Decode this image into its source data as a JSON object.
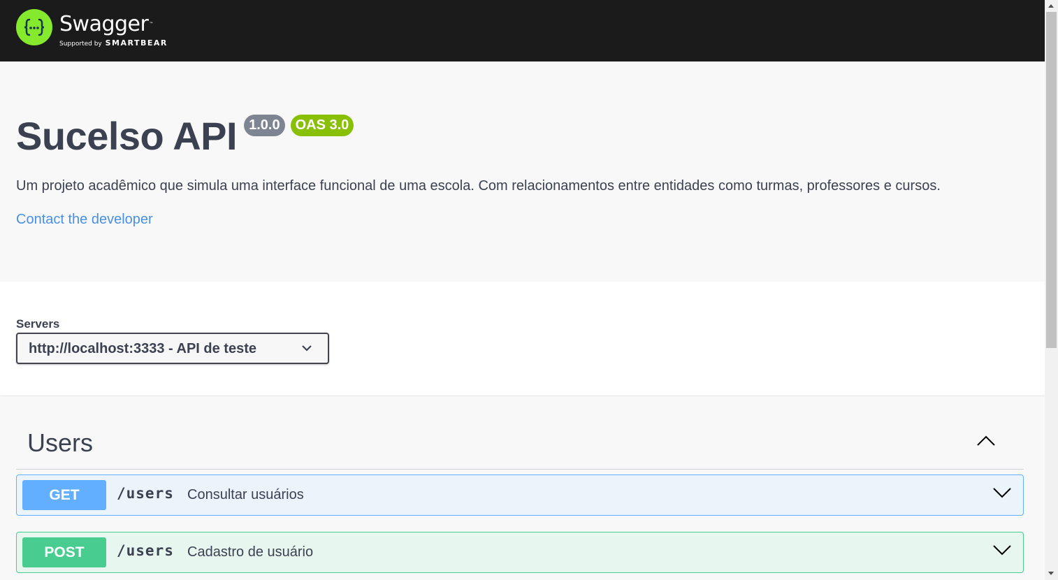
{
  "topbar": {
    "logo_name": "Swagger",
    "logo_tm": "™",
    "supported_by": "Supported by",
    "brand": "SMARTBEAR",
    "logo_color": "#85ea2d"
  },
  "info": {
    "title": "Sucelso API",
    "version_badge": "1.0.0",
    "oas_badge": "OAS 3.0",
    "description": "Um projeto acadêmico que simula uma interface funcional de uma escola. Com relacionamentos entre entidades como turmas, professores e cursos.",
    "contact_link": "Contact the developer"
  },
  "servers": {
    "label": "Servers",
    "selected": "http://localhost:3333 - API de teste"
  },
  "tag": {
    "name": "Users",
    "expanded": true
  },
  "operations": [
    {
      "method": "GET",
      "path": "/users",
      "summary": "Consultar usuários",
      "color": "#61affe"
    },
    {
      "method": "POST",
      "path": "/users",
      "summary": "Cadastro de usuário",
      "color": "#49cc90"
    }
  ],
  "icons": {
    "logo": "swagger-logo-icon",
    "select_arrow": "chevron-down-icon",
    "tag_toggle": "chevron-up-icon",
    "op_toggle": "chevron-down-icon"
  }
}
